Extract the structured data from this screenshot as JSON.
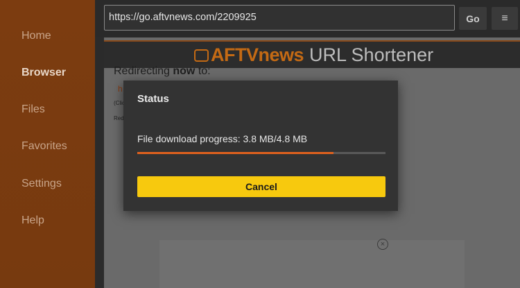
{
  "sidebar": {
    "items": [
      {
        "label": "Home",
        "active": false
      },
      {
        "label": "Browser",
        "active": true
      },
      {
        "label": "Files",
        "active": false
      },
      {
        "label": "Favorites",
        "active": false
      },
      {
        "label": "Settings",
        "active": false
      },
      {
        "label": "Help",
        "active": false
      }
    ]
  },
  "toolbar": {
    "url": "https://go.aftvnews.com/2209925",
    "go_label": "Go",
    "menu_icon": "≡"
  },
  "webpage": {
    "logo_brand": "AFTVnews",
    "logo_rest": "URL Shortener",
    "redirect_prefix": "Redirecting ",
    "redirect_bold": "now",
    "redirect_suffix": " to:",
    "link_fragment": "h",
    "small_fragment_1": "(Clic",
    "small_fragment_2": "Red",
    "ad_close_icon": "×"
  },
  "dialog": {
    "title": "Status",
    "progress_text": "File download progress: 3.8 MB/4.8 MB",
    "progress_fraction": 0.7917,
    "cancel_label": "Cancel"
  },
  "colors": {
    "sidebar_bg": "#7a3a0e",
    "accent_orange": "#e0611e",
    "cancel_yellow": "#f7c90e",
    "dialog_bg": "#333333"
  }
}
